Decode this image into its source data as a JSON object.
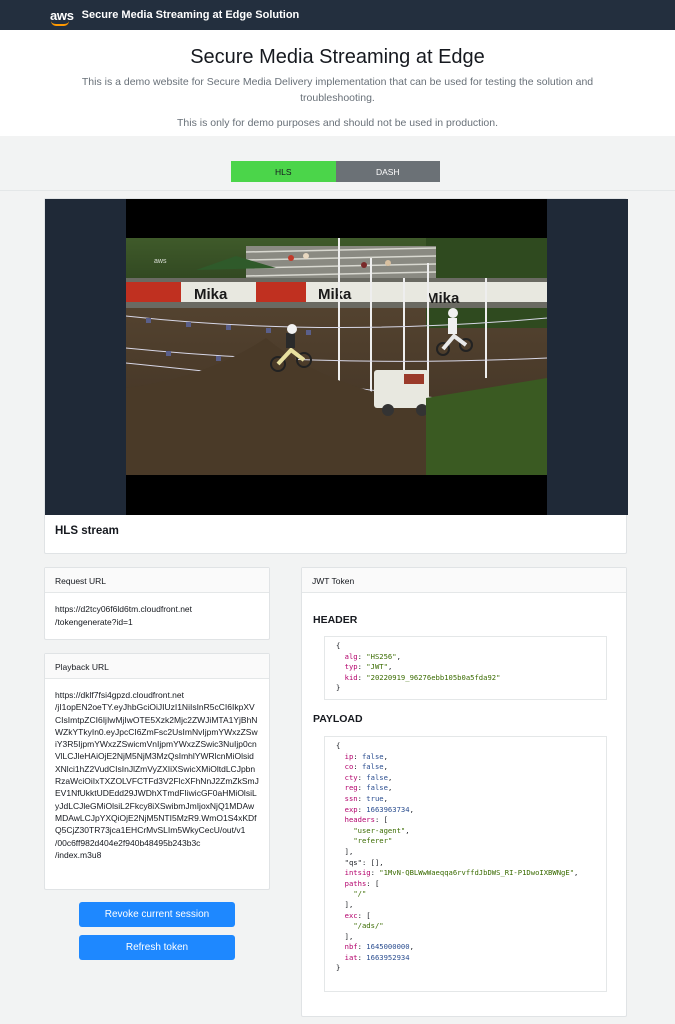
{
  "navbar": {
    "logo_text": "aws",
    "title": "Secure Media Streaming at Edge Solution"
  },
  "hero": {
    "title": "Secure Media Streaming at Edge",
    "description": "This is a demo website for Secure Media Delivery implementation that can be used for testing the solution and troubleshooting.",
    "note": "This is only for demo purposes and should not be used in production."
  },
  "toggle": {
    "hls_label": "HLS",
    "dash_label": "DASH",
    "selected": "HLS"
  },
  "video": {
    "caption": "HLS stream",
    "watermark": "aws",
    "banner_text": "Mika"
  },
  "request_url": {
    "header": "Request URL",
    "value": "https://d2tcy06f6ld6tm.cloudfront.net\n/tokengenerate?id=1"
  },
  "playback_url": {
    "header": "Playback URL",
    "value": "https://dklf7fsi4gpzd.cloudfront.net\n/jI1opEN2oeTY.eyJhbGciOiJIUzI1NiIsInR5cCI6IkpXVCIsImtpZCI6IjIwMjIwOTE5Xzk2Mjc2ZWJiMTA1YjBhNWZkYTkyIn0.eyJpcCI6ZmFsc2UsImNvIjpmYWxzZSwiY3R5IjpmYWxzZSwicmVnIjpmYWxzZSwic3NuIjp0cnVlLCJleHAiOjE2NjM5NjM3MzQsImhlYWRlcnMiOlsidXNlci1hZ2VudCIsInJlZmVyZXIiXSwicXMiOltdLCJpbnRzaWciOiIxTXZOLVFCTFd3V2FlcXFhNnJ2ZmZkSmJEV1NfUkktUDEdd29JWDhXTmdFIiwicGF0aHMiOlsiLyJdLCJleGMiOlsiL2Fkcy8iXSwibmJmIjoxNjQ1MDAwMDAwLCJpYXQiOjE2NjM5NTI5MzR9.WmO1S4xKDfQ5CjZ30TR73jca1EHCrMvSLIm5WkyCecU/out/v1\n/00c6ff982d404e2f940b48495b243b3c\n/index.m3u8"
  },
  "buttons": {
    "revoke": "Revoke current session",
    "refresh": "Refresh token"
  },
  "jwt": {
    "header_title": "JWT Token",
    "header_label": "HEADER",
    "payload_label": "PAYLOAD",
    "header": {
      "alg": "HS256",
      "typ": "JWT",
      "kid": "20220919_96276ebb105b0a5fda92"
    },
    "payload": {
      "ip": "false",
      "co": "false",
      "cty": "false",
      "reg": "false",
      "ssn": "true",
      "exp": "1663963734",
      "headers": [
        "user-agent",
        "referer"
      ],
      "qs": "[]",
      "intsig": "1MvN-QBLWwWaeqqa6rvffdJbDWS_RI-P1DwoIXBWNgE",
      "paths": [
        "/"
      ],
      "exc": [
        "/ads/"
      ],
      "nbf": "1645000000",
      "iat": "1663952934"
    }
  },
  "colors": {
    "navbar": "#232f3e",
    "hls_active": "#4bd54a",
    "dash_inactive": "#6b7176",
    "primary_button": "#1e88ff",
    "aws_orange": "#ff9900"
  }
}
